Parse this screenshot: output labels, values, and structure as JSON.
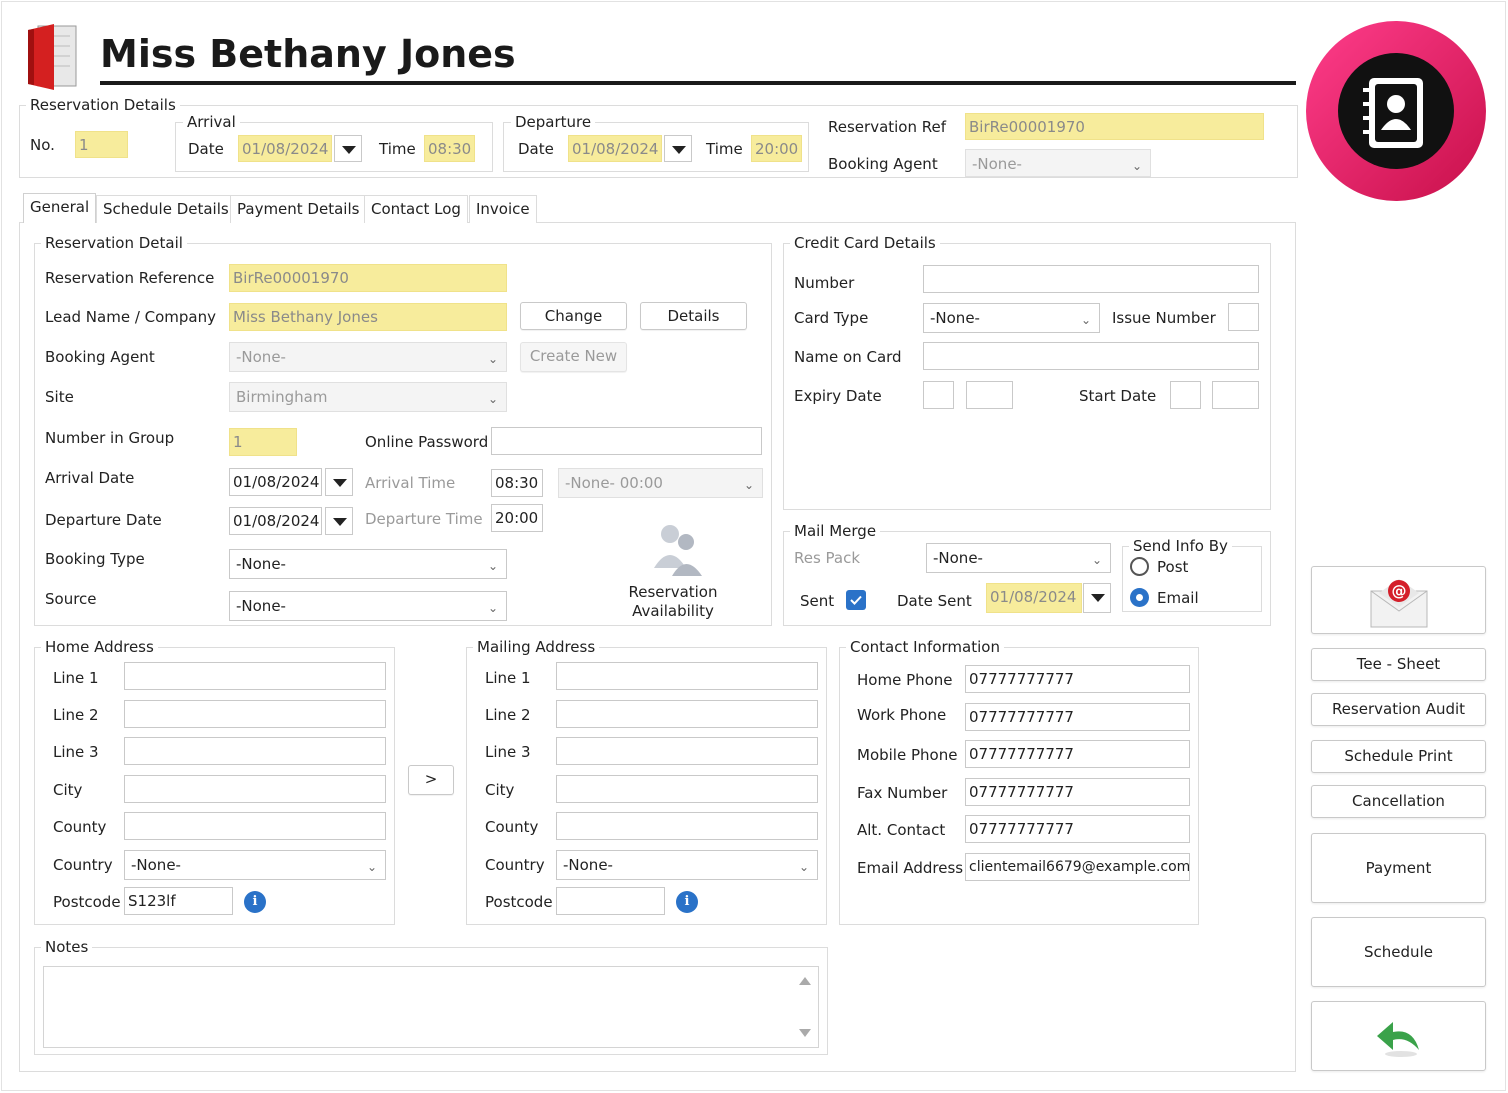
{
  "header": {
    "title": "Miss Bethany Jones"
  },
  "reservation_details": {
    "legend": "Reservation Details",
    "no_label": "No.",
    "no_value": "1",
    "arrival": {
      "legend": "Arrival",
      "date_label": "Date",
      "date": "01/08/2024",
      "time_label": "Time",
      "time": "08:30"
    },
    "departure": {
      "legend": "Departure",
      "date_label": "Date",
      "date": "01/08/2024",
      "time_label": "Time",
      "time": "20:00"
    },
    "ref_label": "Reservation Ref",
    "ref_value": "BirRe00001970",
    "agent_label": "Booking Agent",
    "agent_value": "-None-"
  },
  "tabs": [
    "General",
    "Schedule Details",
    "Payment Details",
    "Contact Log",
    "Invoice"
  ],
  "reservation_detail": {
    "legend": "Reservation Detail",
    "ref_label": "Reservation Reference",
    "ref_value": "BirRe00001970",
    "lead_label": "Lead Name / Company",
    "lead_value": "Miss Bethany Jones",
    "change_btn": "Change",
    "details_btn": "Details",
    "agent_label": "Booking Agent",
    "agent_value": "-None-",
    "create_new_btn": "Create New",
    "site_label": "Site",
    "site_value": "Birmingham",
    "group_label": "Number in Group",
    "group_value": "1",
    "password_label": "Online Password",
    "password_value": "",
    "arrival_date_label": "Arrival Date",
    "arrival_date": "01/08/2024",
    "arrival_time_label": "Arrival Time",
    "arrival_time": "08:30",
    "arrival_time_select": "-None- 00:00",
    "departure_date_label": "Departure Date",
    "departure_date": "01/08/2024",
    "departure_time_label": "Departure Time",
    "departure_time": "20:00",
    "booking_type_label": "Booking Type",
    "booking_type_value": "-None-",
    "source_label": "Source",
    "source_value": "-None-",
    "availability_label_1": "Reservation",
    "availability_label_2": "Availability"
  },
  "credit_card": {
    "legend": "Credit Card Details",
    "number_label": "Number",
    "card_type_label": "Card Type",
    "card_type_value": "-None-",
    "issue_label": "Issue Number",
    "name_label": "Name on Card",
    "expiry_label": "Expiry Date",
    "start_label": "Start Date"
  },
  "mail_merge": {
    "legend": "Mail Merge",
    "res_pack_label": "Res Pack",
    "res_pack_value": "-None-",
    "sent_label": "Sent",
    "date_sent_label": "Date Sent",
    "date_sent_value": "01/08/2024",
    "send_info_legend": "Send Info By",
    "post_label": "Post",
    "email_label": "Email",
    "selected": "Email"
  },
  "home_address": {
    "legend": "Home Address",
    "line1_label": "Line 1",
    "line2_label": "Line 2",
    "line3_label": "Line 3",
    "city_label": "City",
    "county_label": "County",
    "country_label": "Country",
    "country_value": "-None-",
    "postcode_label": "Postcode",
    "postcode_value": "S123lf"
  },
  "copy_button": ">",
  "mailing_address": {
    "legend": "Mailing Address",
    "line1_label": "Line 1",
    "line2_label": "Line 2",
    "line3_label": "Line 3",
    "city_label": "City",
    "county_label": "County",
    "country_label": "Country",
    "country_value": "-None-",
    "postcode_label": "Postcode",
    "postcode_value": ""
  },
  "contact_info": {
    "legend": "Contact Information",
    "home_label": "Home Phone",
    "home_value": "07777777777",
    "work_label": "Work Phone",
    "work_value": "07777777777",
    "mobile_label": "Mobile Phone",
    "mobile_value": "07777777777",
    "fax_label": "Fax Number",
    "fax_value": "07777777777",
    "alt_label": "Alt. Contact",
    "alt_value": "07777777777",
    "email_label": "Email Address",
    "email_value": "clientemail6679@example.com"
  },
  "notes": {
    "legend": "Notes",
    "value": ""
  },
  "sidebar": {
    "tee_sheet": "Tee - Sheet",
    "reservation_audit": "Reservation Audit",
    "schedule_print": "Schedule Print",
    "cancellation": "Cancellation",
    "payment": "Payment",
    "schedule": "Schedule"
  },
  "colors": {
    "highlight": "#f7ec9c",
    "accent_pink": "#e0185e",
    "link_blue": "#2a72c8"
  }
}
